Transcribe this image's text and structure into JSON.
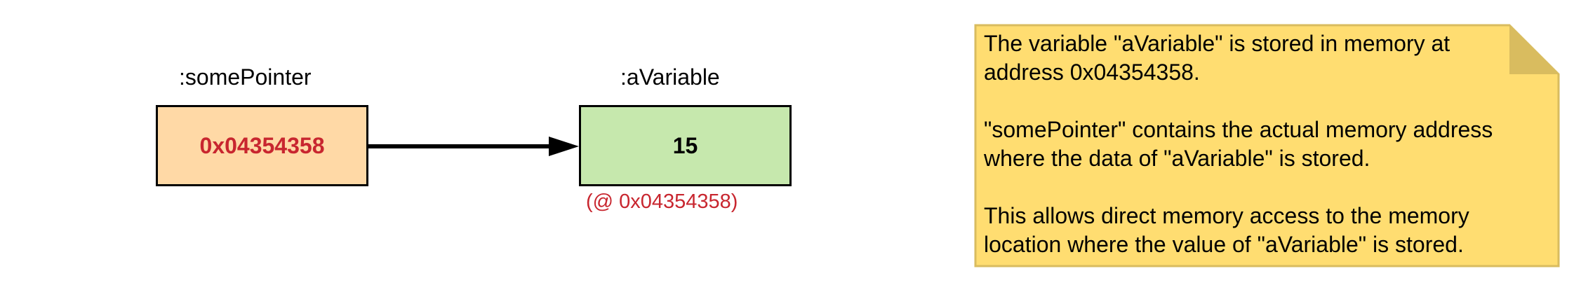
{
  "pointer": {
    "name": ":somePointer",
    "value": "0x04354358",
    "fill_color": "#ffd9a6",
    "text_color": "#c8262f"
  },
  "variable": {
    "name": ":aVariable",
    "value": "15",
    "address_caption": "(@ 0x04354358)",
    "fill_color": "#c6e8ad",
    "caption_color": "#c8262f"
  },
  "note": {
    "fill_color": "#ffdd71",
    "fold_color": "#d9bc5f",
    "paragraphs": [
      "The variable \"aVariable\" is stored in memory at address 0x04354358.",
      "\"somePointer\" contains the actual memory address where the data of \"aVariable\" is stored.",
      "This allows direct memory access to the memory location where the value of \"aVariable\" is stored."
    ]
  }
}
